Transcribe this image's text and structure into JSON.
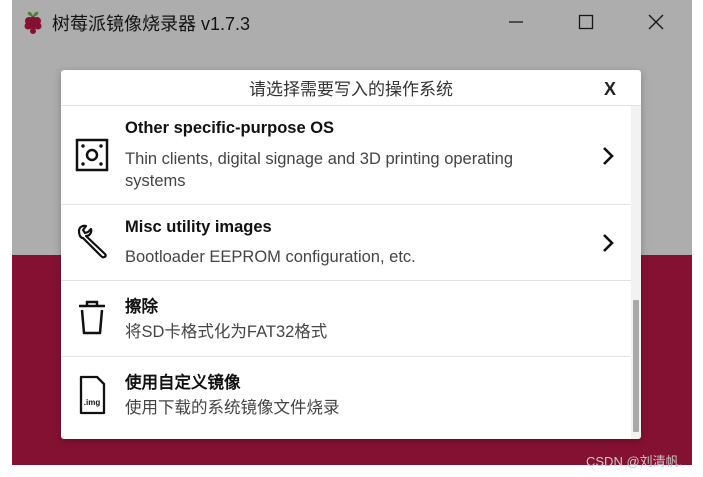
{
  "window": {
    "title": "树莓派镜像烧录器 v1.7.3",
    "brand_color": "#c51a4a"
  },
  "dialog": {
    "title": "请选择需要写入的操作系统",
    "close_label": "X",
    "items": [
      {
        "name": "Other specific-purpose OS",
        "description": "Thin clients, digital signage and 3D printing operating systems",
        "icon": "generic-os-icon",
        "has_submenu": true
      },
      {
        "name": "Misc utility images",
        "description": "Bootloader EEPROM configuration, etc.",
        "icon": "wrench-icon",
        "has_submenu": true
      },
      {
        "name": "擦除",
        "description": "将SD卡格式化为FAT32格式",
        "icon": "trash-icon",
        "has_submenu": false
      },
      {
        "name": "使用自定义镜像",
        "description": "使用下载的系统镜像文件烧录",
        "icon": "img-file-icon",
        "icon_text": ".img",
        "has_submenu": false
      }
    ]
  },
  "watermark": "CSDN @刘清帆."
}
